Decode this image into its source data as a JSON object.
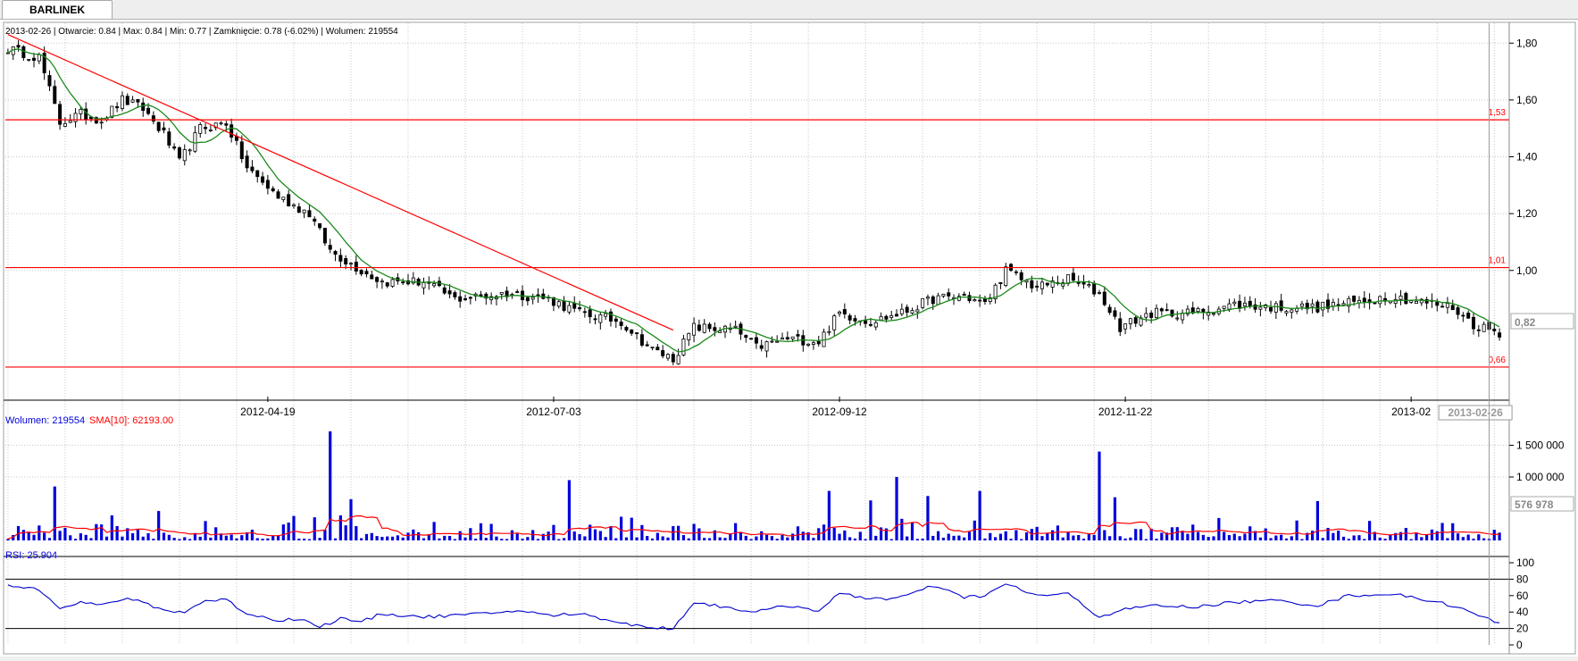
{
  "tab": {
    "label": "BARLINEK"
  },
  "header_info": "2013-02-26 | Otwarcie: 0.84 | Max: 0.84 | Min: 0.77 | Zamknięcie: 0.78 (-6.02%)  | Wolumen: 219554",
  "colors": {
    "candle": "#000000",
    "sma_price": "#1a8a1a",
    "hline": "#ff0000",
    "trendline": "#ff0000",
    "volume_bar": "#0000dd",
    "volume_sma": "#ff0000",
    "rsi": "#0000cc",
    "grid": "#c8c8c8"
  },
  "chart_data": [
    {
      "type": "candlestick",
      "title": "",
      "x_ticks": [
        "2012-04-19",
        "2012-07-03",
        "2012-09-12",
        "2012-11-22",
        "2013-02"
      ],
      "current_date_label": "2013-02-26",
      "ylim": [
        0.6,
        1.87
      ],
      "y_ticks": [
        1.8,
        1.6,
        1.4,
        1.2,
        1.0
      ],
      "y_tick_labels": [
        "1,80",
        "1,60",
        "1,40",
        "1,20",
        "1,00"
      ],
      "last_price_label": "0,82",
      "horizontal_levels": [
        {
          "value": 1.53,
          "label": "1,53"
        },
        {
          "value": 1.01,
          "label": "1,01"
        },
        {
          "value": 0.66,
          "label": "0,66"
        }
      ],
      "trendline": {
        "from": [
          0,
          1.83
        ],
        "to": [
          128,
          0.79
        ]
      },
      "date_indices": [
        50,
        105,
        160,
        215,
        270
      ],
      "sessions": 288,
      "close_anchors": [
        [
          0,
          1.78
        ],
        [
          6,
          1.75
        ],
        [
          10,
          1.52
        ],
        [
          14,
          1.55
        ],
        [
          18,
          1.53
        ],
        [
          22,
          1.6
        ],
        [
          26,
          1.57
        ],
        [
          30,
          1.48
        ],
        [
          33,
          1.38
        ],
        [
          37,
          1.5
        ],
        [
          42,
          1.52
        ],
        [
          46,
          1.36
        ],
        [
          52,
          1.26
        ],
        [
          58,
          1.2
        ],
        [
          62,
          1.07
        ],
        [
          68,
          1.0
        ],
        [
          72,
          0.96
        ],
        [
          80,
          0.96
        ],
        [
          86,
          0.9
        ],
        [
          92,
          0.91
        ],
        [
          96,
          0.92
        ],
        [
          104,
          0.9
        ],
        [
          110,
          0.85
        ],
        [
          118,
          0.82
        ],
        [
          124,
          0.72
        ],
        [
          128,
          0.69
        ],
        [
          132,
          0.8
        ],
        [
          140,
          0.79
        ],
        [
          144,
          0.73
        ],
        [
          150,
          0.76
        ],
        [
          156,
          0.75
        ],
        [
          160,
          0.85
        ],
        [
          166,
          0.82
        ],
        [
          172,
          0.85
        ],
        [
          178,
          0.9
        ],
        [
          184,
          0.91
        ],
        [
          188,
          0.88
        ],
        [
          192,
          1.0
        ],
        [
          198,
          0.94
        ],
        [
          204,
          0.97
        ],
        [
          210,
          0.92
        ],
        [
          214,
          0.8
        ],
        [
          220,
          0.85
        ],
        [
          228,
          0.85
        ],
        [
          236,
          0.88
        ],
        [
          244,
          0.87
        ],
        [
          252,
          0.87
        ],
        [
          260,
          0.89
        ],
        [
          266,
          0.91
        ],
        [
          272,
          0.89
        ],
        [
          278,
          0.87
        ],
        [
          282,
          0.81
        ],
        [
          287,
          0.78
        ]
      ]
    },
    {
      "type": "bar",
      "title_label": "Wolumen: 219554",
      "sma_label": "SMA[10]: 62193.00",
      "ylim": [
        0,
        1760000
      ],
      "y_ticks": [
        1500000,
        1000000
      ],
      "y_tick_labels": [
        "1 500 000",
        "1 000 000"
      ],
      "last_value_label": "576 978",
      "spikes": [
        [
          9,
          850000
        ],
        [
          62,
          1720000
        ],
        [
          66,
          650000
        ],
        [
          108,
          950000
        ],
        [
          158,
          780000
        ],
        [
          166,
          630000
        ],
        [
          171,
          1000000
        ],
        [
          177,
          700000
        ],
        [
          187,
          780000
        ],
        [
          210,
          1400000
        ],
        [
          213,
          680000
        ],
        [
          252,
          620000
        ]
      ]
    },
    {
      "type": "line",
      "title_label": "RSI: 25.904",
      "ylim": [
        0,
        100
      ],
      "y_ticks": [
        100,
        80,
        60,
        40,
        20,
        0
      ],
      "levels": [
        80,
        20
      ],
      "values_anchors": [
        [
          0,
          72
        ],
        [
          6,
          68
        ],
        [
          10,
          46
        ],
        [
          14,
          52
        ],
        [
          18,
          48
        ],
        [
          22,
          56
        ],
        [
          26,
          52
        ],
        [
          30,
          42
        ],
        [
          34,
          40
        ],
        [
          38,
          54
        ],
        [
          42,
          55
        ],
        [
          46,
          38
        ],
        [
          52,
          30
        ],
        [
          56,
          32
        ],
        [
          60,
          22
        ],
        [
          64,
          32
        ],
        [
          68,
          28
        ],
        [
          72,
          38
        ],
        [
          80,
          34
        ],
        [
          86,
          36
        ],
        [
          92,
          38
        ],
        [
          98,
          42
        ],
        [
          104,
          36
        ],
        [
          110,
          38
        ],
        [
          116,
          30
        ],
        [
          122,
          22
        ],
        [
          128,
          20
        ],
        [
          132,
          52
        ],
        [
          138,
          46
        ],
        [
          144,
          40
        ],
        [
          150,
          48
        ],
        [
          156,
          42
        ],
        [
          160,
          62
        ],
        [
          164,
          58
        ],
        [
          170,
          56
        ],
        [
          174,
          62
        ],
        [
          178,
          72
        ],
        [
          184,
          58
        ],
        [
          188,
          60
        ],
        [
          192,
          74
        ],
        [
          198,
          60
        ],
        [
          204,
          62
        ],
        [
          210,
          34
        ],
        [
          214,
          42
        ],
        [
          220,
          48
        ],
        [
          228,
          46
        ],
        [
          236,
          52
        ],
        [
          244,
          54
        ],
        [
          252,
          48
        ],
        [
          258,
          60
        ],
        [
          266,
          62
        ],
        [
          272,
          56
        ],
        [
          278,
          48
        ],
        [
          282,
          38
        ],
        [
          287,
          26
        ]
      ]
    }
  ]
}
